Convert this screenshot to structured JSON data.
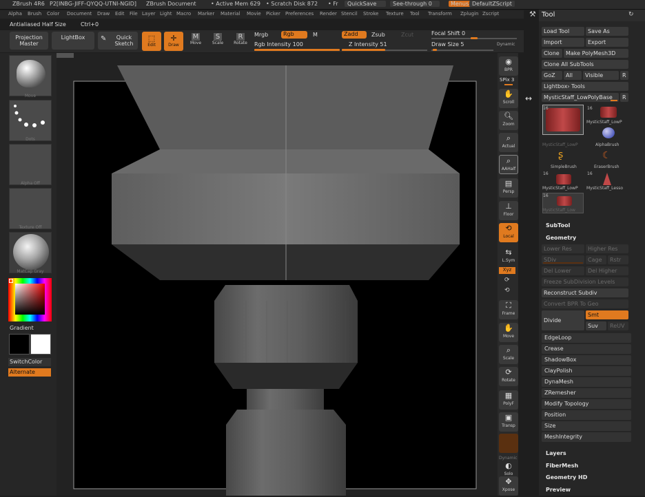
{
  "titlebar": {
    "app": "ZBrush 4R6",
    "doc_id": "P2[INBG-JIFF-QYQQ-UTNI-NGID]",
    "doc": "ZBrush Document",
    "active_mem": "• Active Mem 629",
    "scratch": "• Scratch Disk 872",
    "fr": "• Fr",
    "quicksave": "QuickSave",
    "seethrough": "See-through",
    "seethrough_value": "0",
    "menus": "Menus",
    "defaultzscript": "DefaultZScript"
  },
  "menubar": [
    "Alpha",
    "Brush",
    "Color",
    "Document",
    "Draw",
    "Edit",
    "File",
    "Layer",
    "Light",
    "Macro",
    "Marker",
    "Material",
    "Movie",
    "Picker",
    "Preferences",
    "Render",
    "Stencil",
    "Stroke",
    "Texture",
    "Tool",
    "Transform",
    "Zplugin",
    "Zscript"
  ],
  "status": {
    "antialiased": "Antialiased Half Size",
    "shortcut": "Ctrl+0"
  },
  "shelf": {
    "projection_master": "Projection Master",
    "lightbox": "LightBox",
    "quick_sketch": "Quick Sketch",
    "edit": "Edit",
    "draw": "Draw",
    "move": "Move",
    "scale": "Scale",
    "rotate": "Rotate",
    "mrgb": "Mrgb",
    "rgb": "Rgb",
    "m": "M",
    "rgb_intensity": "Rgb Intensity 100",
    "zadd": "Zadd",
    "zsub": "Zsub",
    "zcut": "Zcut",
    "z_intensity": "Z Intensity 51",
    "focal_shift": "Focal Shift 0",
    "draw_size": "Draw Size 5",
    "dynamic": "Dynamic",
    "rgb_intensity_level": 100,
    "z_intensity_level": 51,
    "focal_shift_level": 0,
    "draw_size_level": 5
  },
  "lefttray": {
    "items": [
      "Move",
      "Dots",
      "Alpha Off",
      "Texture Off",
      "MatCap Gray"
    ],
    "gradient": "Gradient",
    "switchcolor": "SwitchColor",
    "alternate": "Alternate"
  },
  "rightshelf": {
    "bpr": "BPR",
    "spix": "SPix 3",
    "scroll": "Scroll",
    "zoom": "Zoom",
    "actual": "Actual",
    "aahalf": "AAHalf",
    "persp": "Persp",
    "floor": "Floor",
    "local": "Local",
    "lsym": "L.Sym",
    "xyz": "Xyz",
    "frame": "Frame",
    "move": "Move",
    "scale": "Scale",
    "rotate": "Rotate",
    "polyf": "PolyF",
    "transp": "Transp",
    "dynamic": "Dynamic",
    "solo": "Solo",
    "xpose": "Xpose"
  },
  "toolpanel": {
    "title": "Tool",
    "load_tool": "Load Tool",
    "save_as": "Save As",
    "import": "Import",
    "export": "Export",
    "clone": "Clone",
    "make_polymesh": "Make PolyMesh3D",
    "clone_all": "Clone All SubTools",
    "goz": "GoZ",
    "all": "All",
    "visible": "Visible",
    "r": "R",
    "lightbox_tools": "Lightbox› Tools",
    "current_tool": "MysticStaff_LowPolyBase",
    "r2": "R",
    "tools": [
      {
        "label": "MysticStaff_LowP",
        "count": "16"
      },
      {
        "label": "MysticStaff_LowP",
        "count": "16"
      },
      {
        "label": "AlphaBrush",
        "count": ""
      },
      {
        "label": "SimpleBrush",
        "count": ""
      },
      {
        "label": "EraserBrush",
        "count": ""
      },
      {
        "label": "MysticStaff_LowP",
        "count": "16"
      },
      {
        "label": "MysticStaff_Lesso",
        "count": "16"
      },
      {
        "label": "MysticStaff_Low",
        "count": "16"
      }
    ],
    "subtool": "SubTool",
    "geometry": "Geometry",
    "lower_res": "Lower Res",
    "higher_res": "Higher Res",
    "sdiv": "SDiv",
    "cage": "Cage",
    "rstr": "Rstr",
    "del_lower": "Del Lower",
    "del_higher": "Del Higher",
    "freeze_subdiv": "Freeze SubDivision Levels",
    "reconstruct_subdiv": "Reconstruct Subdiv",
    "convert_bpr": "Convert BPR To Geo",
    "divide": "Divide",
    "smt": "Smt",
    "suv": "Suv",
    "ruv": "ReUV",
    "sections": [
      "EdgeLoop",
      "Crease",
      "ShadowBox",
      "ClayPolish",
      "DynaMesh",
      "ZRemesher",
      "Modify Topology",
      "Position",
      "Size",
      "MeshIntegrity"
    ],
    "layers": "Layers",
    "fibermesh": "FiberMesh",
    "geometry_hd": "Geometry HD",
    "preview": "Preview"
  },
  "colors": {
    "accent": "#e07a1f",
    "panel": "#262626",
    "button": "#3a3a3a"
  }
}
